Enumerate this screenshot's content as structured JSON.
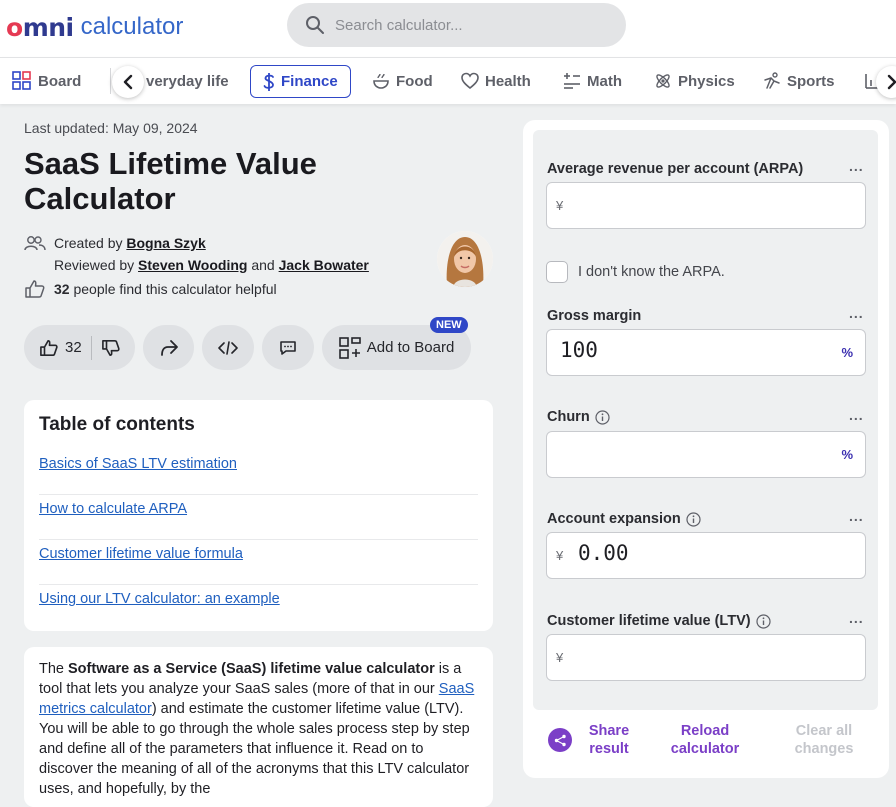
{
  "header": {
    "logo_omni": "omni",
    "logo_calculator": "calculator",
    "search_placeholder": "Search calculator..."
  },
  "nav": {
    "items": [
      {
        "label": "Board",
        "icon": "board-icon"
      },
      {
        "label": "veryday life",
        "icon": "everyday-icon"
      },
      {
        "label": "Finance",
        "icon": "dollar-icon",
        "active": true
      },
      {
        "label": "Food",
        "icon": "food-icon"
      },
      {
        "label": "Health",
        "icon": "heart-icon"
      },
      {
        "label": "Math",
        "icon": "math-icon"
      },
      {
        "label": "Physics",
        "icon": "physics-icon"
      },
      {
        "label": "Sports",
        "icon": "sports-icon"
      }
    ]
  },
  "article": {
    "last_updated": "Last updated: May 09, 2024",
    "title": "SaaS Lifetime Value Calculator",
    "created_by_prefix": "Created by",
    "created_by": "Bogna Szyk",
    "reviewed_by_prefix": "Reviewed by",
    "reviewer_1": "Steven Wooding",
    "and": "and",
    "reviewer_2": "Jack Bowater",
    "helpful_count": "32",
    "helpful_text": "people find this calculator helpful",
    "like_count": "32",
    "add_to_board": "Add to Board",
    "new_badge": "NEW",
    "toc_title": "Table of contents",
    "toc": [
      "Basics of SaaS LTV estimation",
      "How to calculate ARPA",
      "Customer lifetime value formula",
      "Using our LTV calculator: an example"
    ],
    "intro": {
      "p1": "The ",
      "bold": "Software as a Service (SaaS) lifetime value calculator",
      "p2": " is a tool that lets you analyze your SaaS sales (more of that in our ",
      "link": "SaaS metrics calculator",
      "p3": ") and estimate the customer lifetime value (LTV). You will be able to go through the whole sales process step by step and define all of the parameters that influence it. Read on to discover the meaning of all of the acronyms that this LTV calculator uses, and hopefully, by the"
    }
  },
  "calculator": {
    "fields": [
      {
        "label": "Average revenue per account (ARPA)",
        "prefix": "¥",
        "value": "",
        "suffix": ""
      },
      {
        "label": "Gross margin",
        "prefix": "",
        "value": "100",
        "suffix": "%"
      },
      {
        "label": "Churn",
        "prefix": "",
        "value": "",
        "suffix": "%"
      },
      {
        "label": "Account expansion",
        "prefix": "¥",
        "value": "0.00",
        "suffix": ""
      },
      {
        "label": "Customer lifetime value (LTV)",
        "prefix": "¥",
        "value": "",
        "suffix": ""
      }
    ],
    "checkbox_label": "I don't know the ARPA.",
    "more": "...",
    "share": "Share result",
    "reload": "Reload calculator",
    "clear": "Clear all changes"
  }
}
